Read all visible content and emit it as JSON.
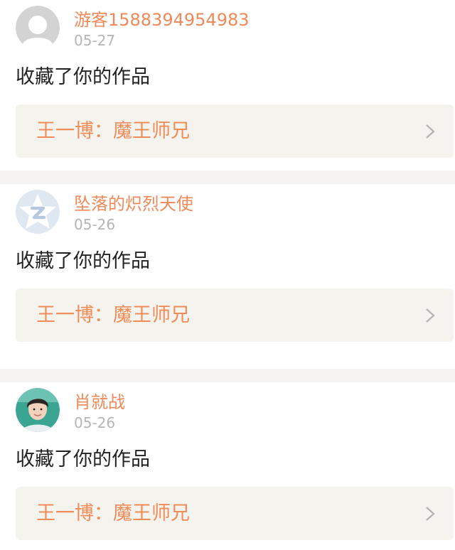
{
  "feed": {
    "items": [
      {
        "user_name": "游客1588394954983",
        "date": "05-27",
        "action": "收藏了你的作品",
        "work_title": "王一博：魔王师兄",
        "avatar": "default-gray-avatar-icon"
      },
      {
        "user_name": "坠落的炽烈天使",
        "date": "05-26",
        "action": "收藏了你的作品",
        "work_title": "王一博：魔王师兄",
        "avatar": "qq-star-avatar-icon"
      },
      {
        "user_name": "肖就战",
        "date": "05-26",
        "action": "收藏了你的作品",
        "work_title": "王一博：魔王师兄",
        "avatar": "photo-avatar"
      }
    ]
  },
  "colors": {
    "name": "#f0895a",
    "date": "#b5b5b5",
    "action_text": "#222222",
    "work_title": "#ef8c58",
    "work_link_bg": "#f4f3ee",
    "divider": "#f4f3f2"
  }
}
